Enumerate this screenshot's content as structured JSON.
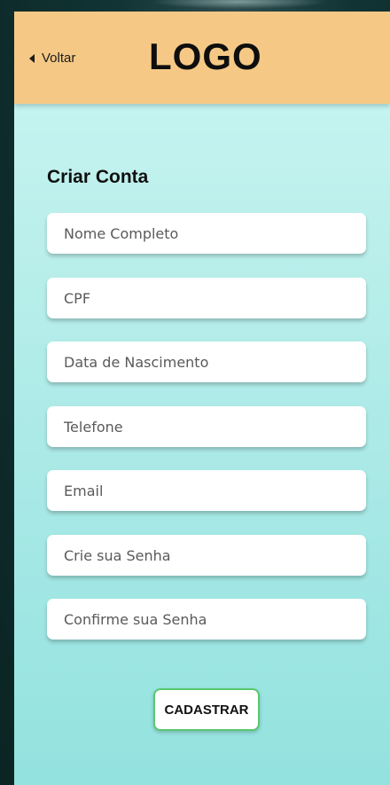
{
  "header": {
    "back_label": "Voltar",
    "logo_text": "LOGO",
    "background_color": "#f5c985"
  },
  "form": {
    "title": "Criar Conta",
    "fields": [
      {
        "placeholder": "Nome Completo",
        "value": ""
      },
      {
        "placeholder": "CPF",
        "value": ""
      },
      {
        "placeholder": "Data de Nascimento",
        "value": ""
      },
      {
        "placeholder": "Telefone",
        "value": ""
      },
      {
        "placeholder": "Email",
        "value": ""
      },
      {
        "placeholder": "Crie sua Senha",
        "value": ""
      },
      {
        "placeholder": "Confirme sua Senha",
        "value": ""
      }
    ],
    "submit_label": "CADASTRAR",
    "submit_border_color": "#58c86e"
  },
  "icons": {
    "back": "chevron-left-icon"
  }
}
